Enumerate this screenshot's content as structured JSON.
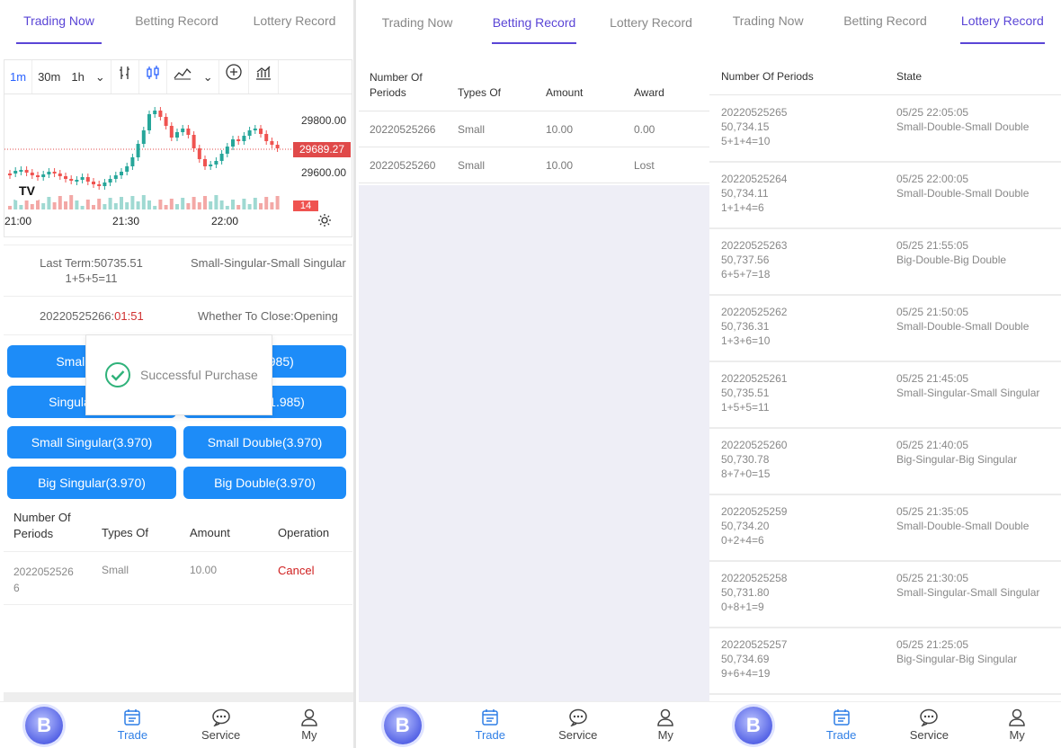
{
  "tabs": [
    "Trading Now",
    "Betting Record",
    "Lottery Record"
  ],
  "nav": {
    "trade": "Trade",
    "service": "Service",
    "my": "My",
    "logo": "B"
  },
  "colors": {
    "accent": "#5a45d6",
    "button": "#1d8cf8",
    "red": "#e04040",
    "up": "#26a69a",
    "down": "#ef5350"
  },
  "chart_toolbar": {
    "intervals": [
      "1m",
      "30m",
      "1h"
    ],
    "active": "1m"
  },
  "chart_data": {
    "type": "candlestick",
    "price_labels": [
      "29800.00",
      "29600.00"
    ],
    "current_price": "29689.27",
    "volume_label": "14",
    "time_labels": [
      "21:00",
      "21:30",
      "22:00"
    ]
  },
  "last_term": {
    "label": "Last Term:50735.51",
    "formula": "1+5+5=11",
    "result": "Small-Singular-Small Singular"
  },
  "current": {
    "period": "20220525266:",
    "countdown": "01:51",
    "status": "Whether To Close:Opening"
  },
  "bet_buttons": [
    [
      "Small(1.985)",
      "Big(1.985)"
    ],
    [
      "Singular(1.985)",
      "Double(1.985)"
    ],
    [
      "Small Singular(3.970)",
      "Small Double(3.970)"
    ],
    [
      "Big Singular(3.970)",
      "Big Double(3.970)"
    ]
  ],
  "toast": {
    "text": "Successful Purchase"
  },
  "orders": {
    "headers": [
      "Number Of",
      "Periods",
      "Types Of",
      "Amount",
      "Operation"
    ],
    "row": {
      "period1": "2022052526",
      "period2": "6",
      "type": "Small",
      "amount": "10.00",
      "op": "Cancel"
    }
  },
  "betting_record": {
    "headers": [
      "Number Of",
      "Periods",
      "Types Of",
      "Amount",
      "Award"
    ],
    "rows": [
      {
        "period": "20220525266",
        "type": "Small",
        "amount": "10.00",
        "award": "0.00"
      },
      {
        "period": "20220525260",
        "type": "Small",
        "amount": "10.00",
        "award": "Lost"
      }
    ]
  },
  "lottery_record": {
    "headers": [
      "Number Of Periods",
      "State"
    ],
    "rows": [
      {
        "period": "20220525265",
        "value": "50,734.15",
        "formula": "5+1+4=10",
        "time": "05/25 22:05:05",
        "state": "Small-Double-Small Double"
      },
      {
        "period": "20220525264",
        "value": "50,734.11",
        "formula": "1+1+4=6",
        "time": "05/25 22:00:05",
        "state": "Small-Double-Small Double"
      },
      {
        "period": "20220525263",
        "value": "50,737.56",
        "formula": "6+5+7=18",
        "time": "05/25 21:55:05",
        "state": "Big-Double-Big Double"
      },
      {
        "period": "20220525262",
        "value": "50,736.31",
        "formula": "1+3+6=10",
        "time": "05/25 21:50:05",
        "state": "Small-Double-Small Double"
      },
      {
        "period": "20220525261",
        "value": "50,735.51",
        "formula": "1+5+5=11",
        "time": "05/25 21:45:05",
        "state": "Small-Singular-Small Singular"
      },
      {
        "period": "20220525260",
        "value": "50,730.78",
        "formula": "8+7+0=15",
        "time": "05/25 21:40:05",
        "state": "Big-Singular-Big Singular"
      },
      {
        "period": "20220525259",
        "value": "50,734.20",
        "formula": "0+2+4=6",
        "time": "05/25 21:35:05",
        "state": "Small-Double-Small Double"
      },
      {
        "period": "20220525258",
        "value": "50,731.80",
        "formula": "0+8+1=9",
        "time": "05/25 21:30:05",
        "state": "Small-Singular-Small Singular"
      },
      {
        "period": "20220525257",
        "value": "50,734.69",
        "formula": "9+6+4=19",
        "time": "05/25 21:25:05",
        "state": "Big-Singular-Big Singular"
      }
    ]
  }
}
